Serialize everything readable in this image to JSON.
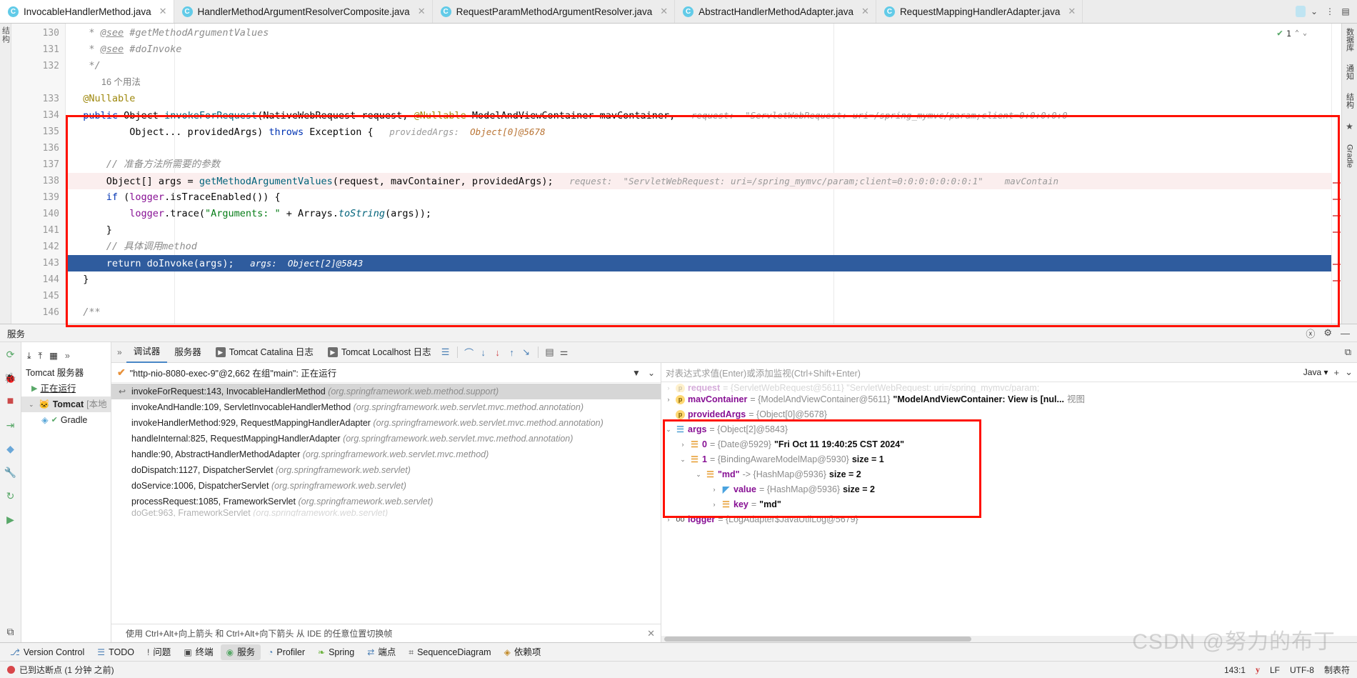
{
  "tabs": [
    {
      "label": "InvocableHandlerMethod.java",
      "active": true
    },
    {
      "label": "HandlerMethodArgumentResolverComposite.java",
      "active": false
    },
    {
      "label": "RequestParamMethodArgumentResolver.java",
      "active": false
    },
    {
      "label": "AbstractHandlerMethodAdapter.java",
      "active": false
    },
    {
      "label": "RequestMappingHandlerAdapter.java",
      "active": false
    }
  ],
  "tabbar": {
    "chevron_icon": "chevron-down",
    "more_icon": "vertical-dots",
    "db_icon": "database"
  },
  "editor": {
    "inspection_count": "1",
    "lines": [
      {
        "num": "130",
        "text": " * @see #getMethodArgumentValues"
      },
      {
        "num": "131",
        "text": " * @doInvoke"
      },
      {
        "num": "132",
        "text": " */"
      },
      {
        "num": "",
        "text": "16 个用法"
      },
      {
        "num": "133",
        "text": "@Nullable"
      },
      {
        "num": "134",
        "text": "public Object invokeForRequest(NativeWebRequest request, @Nullable ModelAndViewContainer mavContainer,"
      },
      {
        "num": "135",
        "text": "        Object... providedArgs) throws Exception {"
      },
      {
        "num": "136",
        "text": ""
      },
      {
        "num": "137",
        "text": "    // 准备方法所需要的参数"
      },
      {
        "num": "138",
        "text": "    Object[] args = getMethodArgumentValues(request, mavContainer, providedArgs);"
      },
      {
        "num": "139",
        "text": "    if (logger.isTraceEnabled()) {"
      },
      {
        "num": "140",
        "text": "        logger.trace(\"Arguments: \" + Arrays.toString(args));"
      },
      {
        "num": "141",
        "text": "    }"
      },
      {
        "num": "142",
        "text": "    // 具体调用method"
      },
      {
        "num": "143",
        "text": "    return doInvoke(args);"
      },
      {
        "num": "144",
        "text": "}"
      },
      {
        "num": "145",
        "text": ""
      },
      {
        "num": "146",
        "text": "/**"
      }
    ],
    "usages_label": "16 个用法",
    "inlay_request_134": "request:  \"ServletWebRequest: uri=/spring_mymvc/param;client=0:0:0:0:0",
    "inlay_provided_135": "providedArgs:  Object[0]@5678",
    "inlay_request_138": "request:  \"ServletWebRequest: uri=/spring_mymvc/param;client=0:0:0:0:0:0:0:1\"",
    "inlay_mav_138": "mavContain",
    "inlay_args_143": "args:  Object[2]@5843",
    "comment_137": "// 准备方法所需要的参数",
    "comment_142": "// 具体调用method"
  },
  "right_rail": {
    "items": [
      "数据库",
      "通知",
      "结构",
      "书签",
      "Gradle"
    ]
  },
  "left_strip": {
    "label": "结构"
  },
  "services": {
    "title": "服务",
    "header_icons": [
      "help-icon",
      "settings-icon",
      "minimize-icon"
    ],
    "toolbar_icons": [
      "rerun-icon",
      "debug-icon",
      "stop-icon",
      "resume-icon",
      "mute-breakpoints-icon",
      "settings-wrench-icon",
      "restart-icon",
      "play-icon",
      "layout-icon"
    ],
    "tree": {
      "root": "Tomcat 服务器",
      "running": "正在运行",
      "node": "Tomcat",
      "node_suffix": "[本地",
      "child": "Gradle"
    },
    "tree_toolbar": [
      "expand-all-icon",
      "collapse-all-icon",
      "group-icon",
      "more-icon"
    ]
  },
  "debugger": {
    "tabs": [
      {
        "label": "调试器",
        "active": true,
        "icon": ""
      },
      {
        "label": "服务器",
        "active": false,
        "icon": ""
      },
      {
        "label": "Tomcat Catalina 日志",
        "active": false,
        "icon": "console-icon"
      },
      {
        "label": "Tomcat Localhost 日志",
        "active": false,
        "icon": "console-icon"
      }
    ],
    "step_icons": [
      "show-execution-point-icon",
      "step-over-icon",
      "step-into-icon",
      "force-step-into-icon",
      "step-out-icon",
      "run-to-cursor-icon",
      "evaluate-icon",
      "settings-icon"
    ],
    "thread": "\"http-nio-8080-exec-9\"@2,662 在组\"main\": 正在运行",
    "thread_status_icon": "check-icon",
    "filter_icon": "filter-icon",
    "filter_chevron_icon": "chevron-down-icon",
    "frames": [
      {
        "method": "invokeForRequest:143, InvocableHandlerMethod",
        "pkg": "(org.springframework.web.method.support)",
        "selected": true
      },
      {
        "method": "invokeAndHandle:109, ServletInvocableHandlerMethod",
        "pkg": "(org.springframework.web.servlet.mvc.method.annotation)",
        "selected": false
      },
      {
        "method": "invokeHandlerMethod:929, RequestMappingHandlerAdapter",
        "pkg": "(org.springframework.web.servlet.mvc.method.annotation)",
        "selected": false
      },
      {
        "method": "handleInternal:825, RequestMappingHandlerAdapter",
        "pkg": "(org.springframework.web.servlet.mvc.method.annotation)",
        "selected": false
      },
      {
        "method": "handle:90, AbstractHandlerMethodAdapter",
        "pkg": "(org.springframework.web.servlet.mvc.method)",
        "selected": false
      },
      {
        "method": "doDispatch:1127, DispatcherServlet",
        "pkg": "(org.springframework.web.servlet)",
        "selected": false
      },
      {
        "method": "doService:1006, DispatcherServlet",
        "pkg": "(org.springframework.web.servlet)",
        "selected": false
      },
      {
        "method": "processRequest:1085, FrameworkServlet",
        "pkg": "(org.springframework.web.servlet)",
        "selected": false
      },
      {
        "method": "doGet:963, FrameworkServlet",
        "pkg": "(org.springframework.web.servlet)",
        "selected": false
      }
    ],
    "hint_bar": "使用 Ctrl+Alt+向上箭头 和 Ctrl+Alt+向下箭头 从 IDE 的任意位置切换帧"
  },
  "watch": {
    "placeholder": "对表达式求值(Enter)或添加监视(Ctrl+Shift+Enter)",
    "language": "Java",
    "add_icon": "plus-icon",
    "chevron_icon": "chevron-down-icon"
  },
  "variables": [
    {
      "indent": 0,
      "caret": "collapsed",
      "badge": "p",
      "name": "request",
      "value": " = {ServletWebRequest@5611} \"ServletWebRequest: uri=/spring_mymvc/param;",
      "clipped": true
    },
    {
      "indent": 0,
      "caret": "collapsed",
      "badge": "p",
      "name": "mavContainer",
      "ref": " = {ModelAndViewContainer@5611} ",
      "strv": "\"ModelAndViewContainer: View is [nul...",
      "suffix": "视图"
    },
    {
      "indent": 0,
      "caret": "none",
      "badge": "p",
      "name": "providedArgs",
      "ref": " = {Object[0]@5678}"
    },
    {
      "indent": 0,
      "caret": "expanded",
      "badge": "array",
      "name": "args",
      "ref": " = {Object[2]@5843}"
    },
    {
      "indent": 1,
      "caret": "collapsed",
      "badge": "item",
      "name": "0",
      "ref": " = {Date@5929} ",
      "strv": "\"Fri Oct 11 19:40:25 CST 2024\""
    },
    {
      "indent": 1,
      "caret": "expanded",
      "badge": "item",
      "name": "1",
      "ref": " = {BindingAwareModelMap@5930} ",
      "size": "size = 1"
    },
    {
      "indent": 2,
      "caret": "expanded",
      "badge": "item",
      "name": "\"md\"",
      "ref": " -> {HashMap@5936} ",
      "size": "size = 2"
    },
    {
      "indent": 3,
      "caret": "collapsed",
      "badge": "flag",
      "name": "value",
      "ref": " = {HashMap@5936} ",
      "size": "size = 2"
    },
    {
      "indent": 3,
      "caret": "collapsed",
      "badge": "item",
      "name": "key",
      "ref": " = ",
      "strv": "\"md\""
    },
    {
      "indent": 0,
      "caret": "collapsed",
      "badge": "oo",
      "name": "logger",
      "ref": " = {LogAdapter$JavaUtilLog@5679}"
    }
  ],
  "watermark": "CSDN @努力的布丁",
  "bottom_bar": [
    {
      "label": "Version Control",
      "icon": "branch-icon",
      "active": false
    },
    {
      "label": "TODO",
      "icon": "list-icon",
      "active": false
    },
    {
      "label": "问题",
      "icon": "warning-icon",
      "active": false
    },
    {
      "label": "终端",
      "icon": "terminal-icon",
      "active": false
    },
    {
      "label": "服务",
      "icon": "services-icon",
      "active": true
    },
    {
      "label": "Profiler",
      "icon": "profiler-icon",
      "active": false
    },
    {
      "label": "Spring",
      "icon": "spring-icon",
      "active": false
    },
    {
      "label": "端点",
      "icon": "endpoints-icon",
      "active": false
    },
    {
      "label": "SequenceDiagram",
      "icon": "diagram-icon",
      "active": false
    },
    {
      "label": "依赖项",
      "icon": "dependencies-icon",
      "active": false
    }
  ],
  "statusbar": {
    "message": "已到达断点 (1 分钟 之前)",
    "caret": "143:1",
    "y_indicator": "y",
    "line_sep": "LF",
    "encoding": "UTF-8",
    "indent": "制表符"
  },
  "colors": {
    "accent_blue": "#2f5c9e",
    "annotation_red": "#ff1100",
    "keyword": "#0033b3",
    "string": "#067d17",
    "field": "#871094",
    "comment": "#8c8c8c",
    "tab_icon": "#62cbe8"
  }
}
